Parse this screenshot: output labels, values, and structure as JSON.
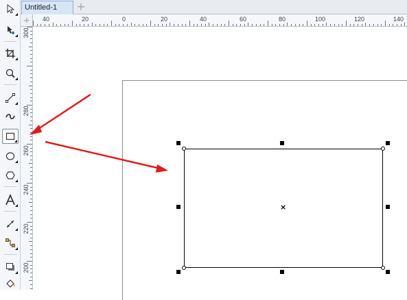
{
  "tabs": {
    "document_tab_label": "Untitled-1",
    "new_tab_symbol": "+"
  },
  "toolbox": {
    "tools": [
      {
        "name": "pick-tool",
        "icon": "pointer-icon"
      },
      {
        "name": "shape-tool",
        "icon": "shape-node-icon"
      },
      {
        "name": "crop-tool",
        "icon": "crop-icon"
      },
      {
        "name": "zoom-tool",
        "icon": "zoom-icon"
      },
      {
        "name": "freehand-tool",
        "icon": "freehand-line-icon"
      },
      {
        "name": "artistic-media-tool",
        "icon": "artistic-media-icon"
      },
      {
        "name": "rectangle-tool",
        "icon": "rectangle-icon",
        "selected": true
      },
      {
        "name": "ellipse-tool",
        "icon": "ellipse-icon"
      },
      {
        "name": "polygon-tool",
        "icon": "polygon-icon"
      },
      {
        "name": "text-tool",
        "icon": "text-a-icon"
      },
      {
        "name": "dimension-tool",
        "icon": "dimension-icon"
      },
      {
        "name": "connector-tool",
        "icon": "connector-icon"
      },
      {
        "name": "drop-shadow-tool",
        "icon": "drop-shadow-icon"
      },
      {
        "name": "fill-tool",
        "icon": "fill-bucket-icon"
      }
    ]
  },
  "rulers": {
    "horizontal_labels": [
      "40",
      "20",
      "0",
      "20",
      "40",
      "60",
      "80",
      "100",
      "120",
      "140"
    ],
    "vertical_labels": [
      "300",
      "280",
      "260",
      "240",
      "220",
      "200"
    ]
  },
  "colors": {
    "arrow": "#e01b1b",
    "tab_active": "#d6e6f7",
    "toolbox_bg": "#f4f6f9"
  }
}
